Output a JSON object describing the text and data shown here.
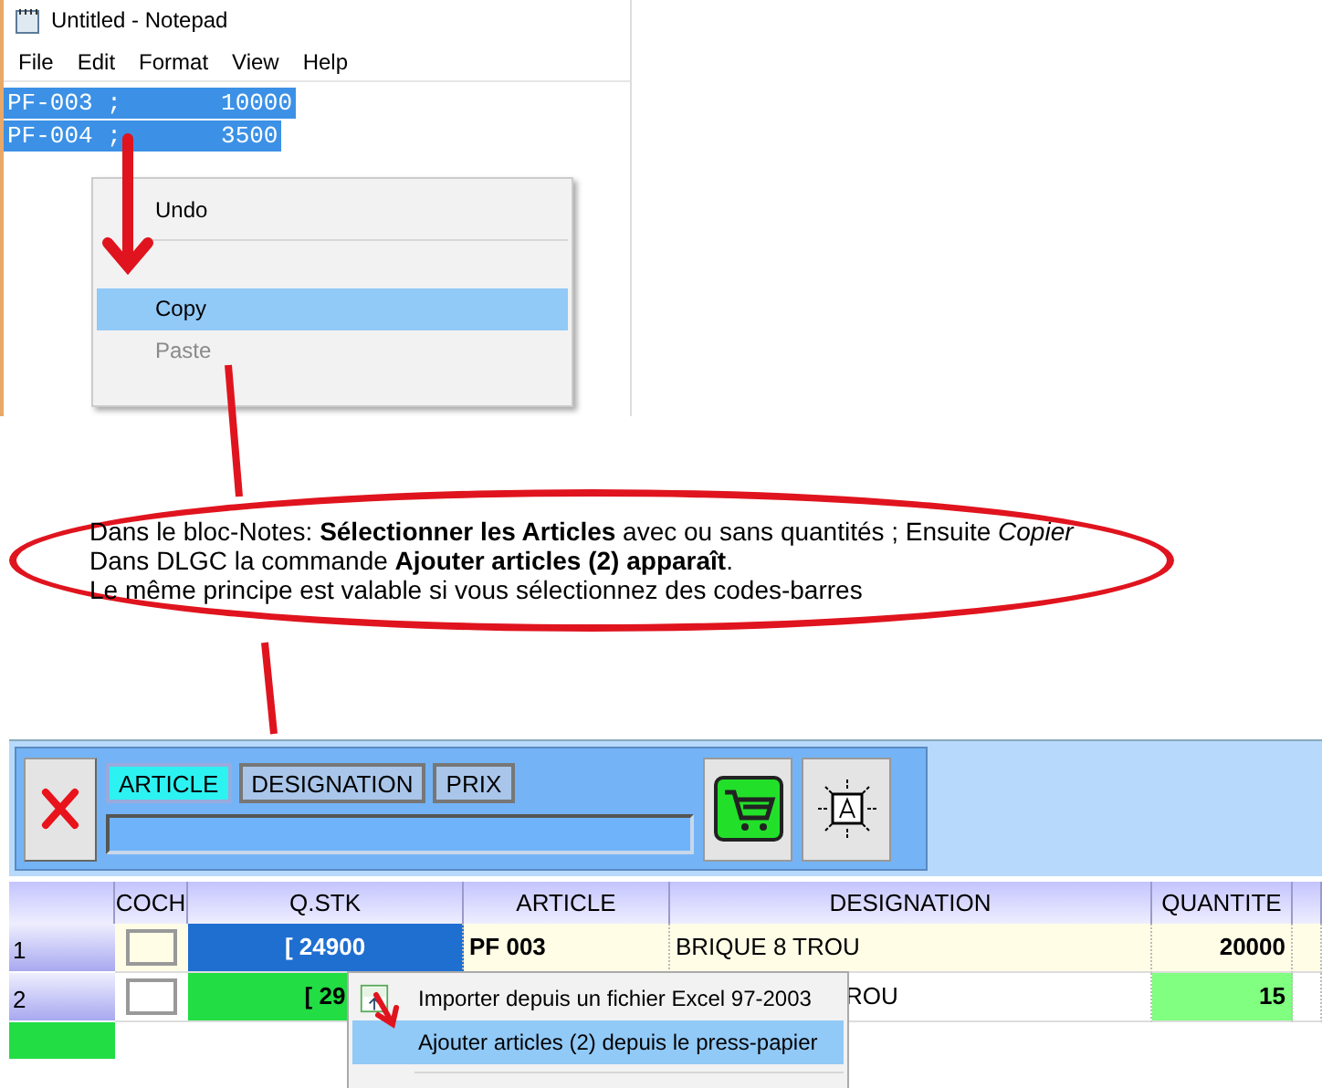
{
  "notepad": {
    "title": "Untitled - Notepad",
    "menu": [
      "File",
      "Edit",
      "Format",
      "View",
      "Help"
    ],
    "lines": [
      {
        "text": "PF-003 ;       10000",
        "selected": true
      },
      {
        "text": "PF-004 ;       3500",
        "selected": true
      }
    ],
    "context_menu": [
      {
        "label": "Undo",
        "selected": false,
        "disabled": false
      },
      {
        "label": "Copy",
        "selected": true,
        "disabled": false
      },
      {
        "label": "Paste",
        "selected": false,
        "disabled": true
      }
    ]
  },
  "note": {
    "lines": [
      "Dans le bloc-Notes: **Sélectionner les Articles** avec ou sans quantités ; Ensuite *Copier*",
      "Dans DLGC  la commande **Ajouter articles (2) apparaît**.",
      "Le même principe est valable si vous sélectionnez des codes-barres"
    ]
  },
  "app": {
    "tabs": [
      {
        "label": "ARTICLE",
        "selected": true
      },
      {
        "label": "DESIGNATION",
        "selected": false
      },
      {
        "label": "PRIX",
        "selected": false
      }
    ],
    "columns": [
      "COCH",
      "Q.STK",
      "ARTICLE",
      "DESIGNATION",
      "QUANTITE"
    ],
    "rows": [
      {
        "number": "1",
        "checked": false,
        "selected": true,
        "stock": "[ 24900",
        "color": "#1f6fd1",
        "article": "PF 003",
        "designation": "BRIQUE 8 TROU",
        "quantity": "20000",
        "modified": false
      },
      {
        "number": "2",
        "checked": false,
        "selected": false,
        "stock": "[ 29",
        "color": "#22dd44",
        "designation": "ROU",
        "quantity": "15",
        "modified": true
      }
    ],
    "context_menu": [
      {
        "label": "Importer depuis un fichier Excel 97-2003",
        "kind": "xls",
        "selected": false
      },
      {
        "label": "Ajouter articles (2) depuis le press-papier",
        "kind": "plain",
        "selected": true
      }
    ]
  }
}
